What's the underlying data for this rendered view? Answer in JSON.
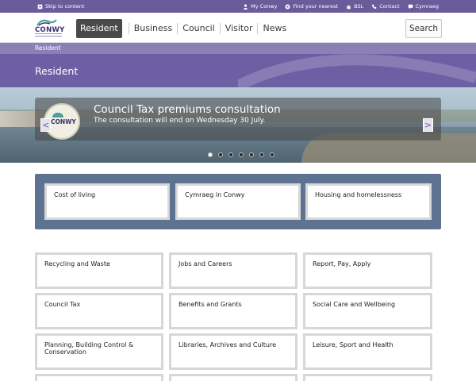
{
  "utility": {
    "skip_label": "Skip to content",
    "links": [
      {
        "label": "My Conwy",
        "icon": "person-icon"
      },
      {
        "label": "Find your nearest",
        "icon": "location-icon"
      },
      {
        "label": "BSL",
        "icon": "hand-icon"
      },
      {
        "label": "Contact",
        "icon": "phone-icon"
      },
      {
        "label": "Cymraeg",
        "icon": "speech-bubble-icon"
      }
    ]
  },
  "header": {
    "logo_text": "CONWY",
    "nav": [
      "Resident",
      "Business",
      "Council",
      "Visitor",
      "News"
    ],
    "active_nav": "Resident",
    "search_label": "Search"
  },
  "breadcrumb": "Resident",
  "page_title": "Resident",
  "hero": {
    "badge_text": "CONWY",
    "title": "Council Tax premiums consultation",
    "subtitle": "The consultation will end on Wednesday 30 July.",
    "prev_label": "<",
    "next_label": ">",
    "slide_count": 7,
    "active_slide": 1
  },
  "featured": [
    "Cost of living",
    "Cymraeg in Conwy",
    "Housing and homelessness"
  ],
  "tiles": [
    "Recycling and Waste",
    "Jobs and Careers",
    "Report, Pay, Apply",
    "Council Tax",
    "Benefits and Grants",
    "Social Care and Wellbeing",
    "Planning, Building Control & Conservation",
    "Libraries, Archives and Culture",
    "Leisure, Sport and Health"
  ],
  "colors": {
    "utility_bar": "#6a5b9a",
    "title_bar": "#6e5fa4",
    "breadcrumb_bar": "#8b7fb5",
    "featured_panel": "#5e7391",
    "active_nav": "#4a4a4a"
  }
}
